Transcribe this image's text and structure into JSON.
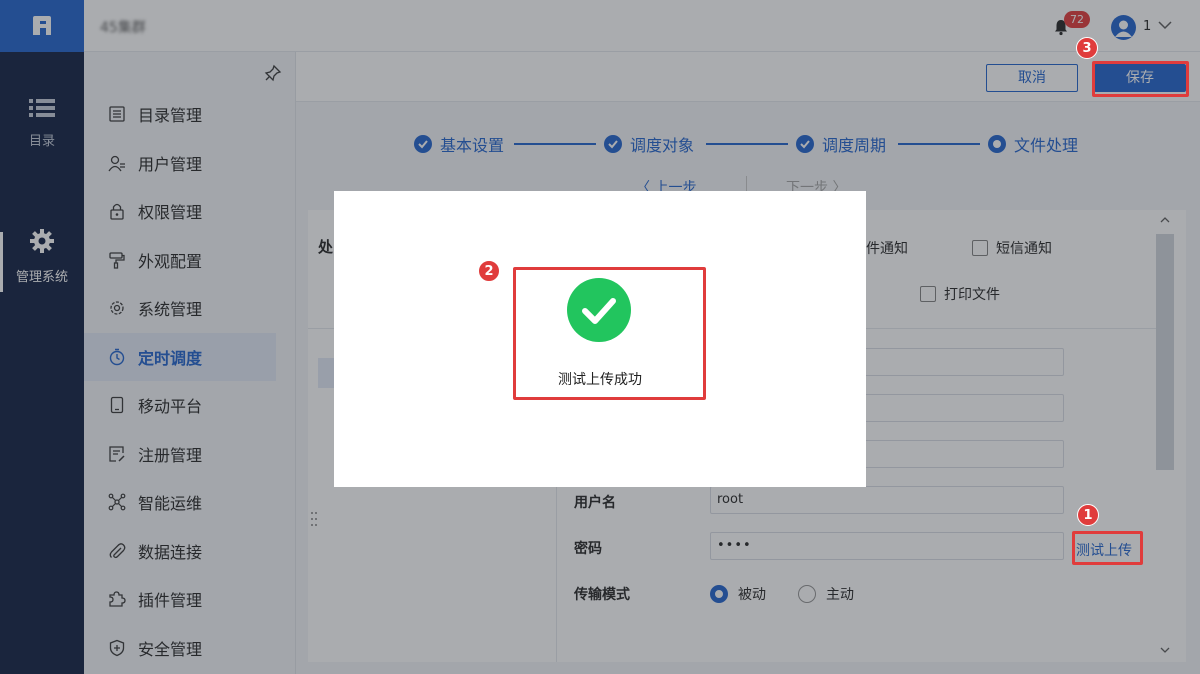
{
  "header": {
    "brand": "45集群",
    "notifications_count": "72",
    "user_name": "1"
  },
  "rail": {
    "items": [
      {
        "label": "目录",
        "icon": "list-icon"
      },
      {
        "label": "管理系统",
        "icon": "gear-icon"
      }
    ]
  },
  "sidebar": {
    "items": [
      {
        "label": "目录管理",
        "icon": "catalog-icon"
      },
      {
        "label": "用户管理",
        "icon": "user-icon"
      },
      {
        "label": "权限管理",
        "icon": "lock-icon"
      },
      {
        "label": "外观配置",
        "icon": "paint-roller-icon"
      },
      {
        "label": "系统管理",
        "icon": "cog-icon"
      },
      {
        "label": "定时调度",
        "icon": "timer-icon"
      },
      {
        "label": "移动平台",
        "icon": "tablet-icon"
      },
      {
        "label": "注册管理",
        "icon": "register-icon"
      },
      {
        "label": "智能运维",
        "icon": "network-icon"
      },
      {
        "label": "数据连接",
        "icon": "paperclip-icon"
      },
      {
        "label": "插件管理",
        "icon": "puzzle-icon"
      },
      {
        "label": "安全管理",
        "icon": "shield-icon"
      }
    ],
    "active_index": 5
  },
  "toolbar": {
    "cancel_label": "取消",
    "save_label": "保存"
  },
  "steps": [
    {
      "label": "基本设置",
      "state": "done"
    },
    {
      "label": "调度对象",
      "state": "done"
    },
    {
      "label": "调度周期",
      "state": "done"
    },
    {
      "label": "文件处理",
      "state": "current"
    }
  ],
  "nav": {
    "prev": "〈 上一步",
    "next": "下一步 〉"
  },
  "panel": {
    "title": "处",
    "checkboxes": [
      {
        "label": "邮件通知"
      },
      {
        "label": "短信通知"
      },
      {
        "label": "打印文件"
      }
    ],
    "fields": {
      "username_label": "用户名",
      "username_value": "root",
      "password_label": "密码",
      "password_value": "••••",
      "mode_label": "传输模式"
    },
    "test_upload": "测试上传",
    "modes": [
      {
        "label": "被动",
        "selected": true
      },
      {
        "label": "主动",
        "selected": false
      }
    ]
  },
  "modal": {
    "message": "测试上传成功"
  },
  "annotations": [
    "1",
    "2",
    "3"
  ],
  "colors": {
    "accent": "#2e6cd1",
    "rail": "#1f2d4d",
    "success": "#22c55e",
    "annotation": "#e03c3c"
  }
}
